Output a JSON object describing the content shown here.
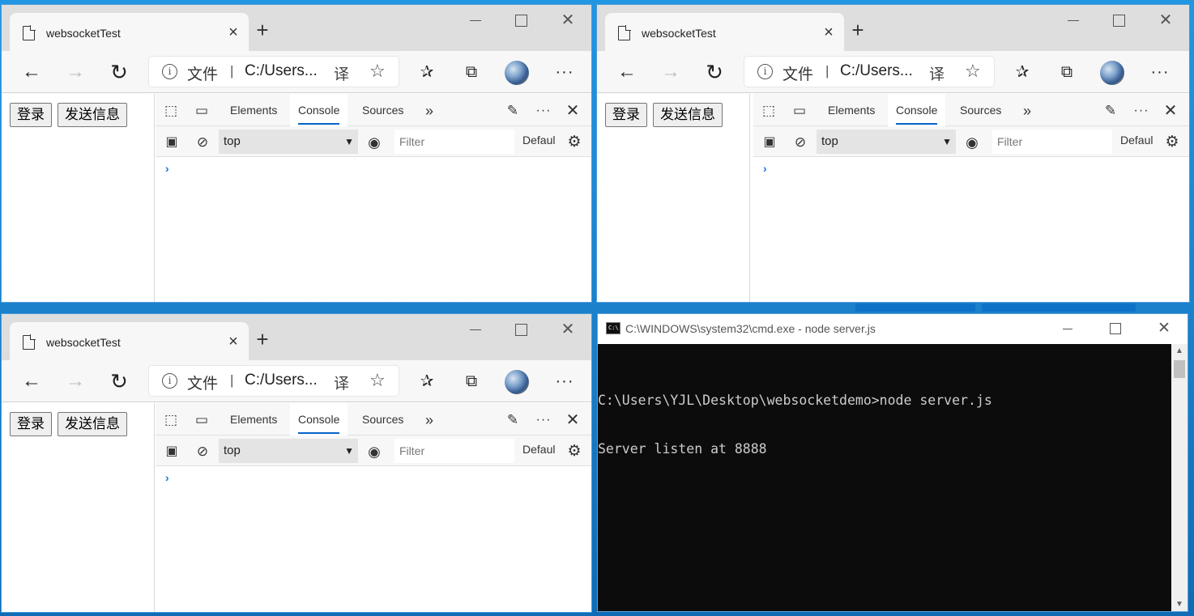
{
  "browser": {
    "tab_title": "websocketTest",
    "tab_close": "×",
    "new_tab": "+",
    "address_file_label": "文件",
    "address_separator": "|",
    "address_url": "C:/Users...",
    "page_buttons": {
      "login": "登录",
      "send": "发送信息"
    },
    "devtools": {
      "tabs": [
        "Elements",
        "Console",
        "Sources"
      ],
      "active_tab": "Console",
      "more_tabs": "»",
      "context": "top",
      "filter_placeholder": "Filter",
      "levels_label": "Defaul",
      "prompt": "›"
    }
  },
  "cmd": {
    "title": "C:\\WINDOWS\\system32\\cmd.exe - node  server.js",
    "icon_text": "C:\\",
    "lines": [
      "C:\\Users\\YJL\\Desktop\\websocketdemo>node server.js",
      "Server listen at 8888"
    ]
  },
  "icons": {
    "page": "page-icon",
    "back": "back-arrow-icon",
    "forward": "forward-arrow-icon",
    "reload": "reload-icon",
    "info": "info-icon",
    "translate": "translate-icon",
    "favorite": "star-icon",
    "favorites": "favorites-icon",
    "collections": "collections-icon",
    "more": "more-icon",
    "inspect": "inspect-icon",
    "device": "device-emulation-icon",
    "feedback": "feedback-icon",
    "close": "close-icon",
    "sidebar": "sidebar-icon",
    "clear": "clear-console-icon",
    "eye": "eye-icon",
    "gear": "gear-icon"
  },
  "colors": {
    "desktop": "#1a8fd8",
    "active_tab_underline": "#0a63c9",
    "cmd_bg": "#0c0c0c",
    "cmd_text": "#cccccc",
    "prompt": "#1a73e8"
  }
}
